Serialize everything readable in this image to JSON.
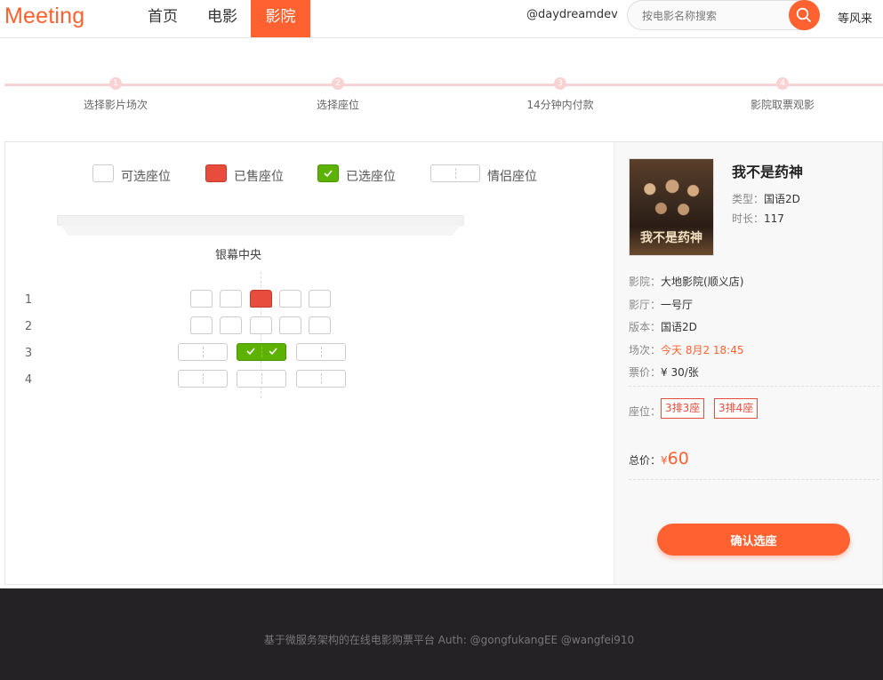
{
  "header": {
    "logo": "Meeting",
    "nav": [
      "首页",
      "电影",
      "影院"
    ],
    "user": "@daydreamdev",
    "search_placeholder": "按电影名称搜索",
    "right_user": "等风来"
  },
  "steps": [
    "选择影片场次",
    "选择座位",
    "14分钟内付款",
    "影院取票观影"
  ],
  "legend": {
    "available": "可选座位",
    "sold": "已售座位",
    "selected": "已选座位",
    "couple": "情侣座位"
  },
  "screen_label": "银幕中央",
  "rows": [
    "1",
    "2",
    "3",
    "4"
  ],
  "movie": {
    "title": "我不是药神",
    "type_label": "类型：",
    "type": "国语2D",
    "duration_label": "时长：",
    "duration": "117"
  },
  "order": {
    "cinema_label": "影院：",
    "cinema": "大地影院(顺义店)",
    "hall_label": "影厅：",
    "hall": "一号厅",
    "version_label": "版本：",
    "version": "国语2D",
    "session_label": "场次：",
    "session": "今天 8月2 18:45",
    "ticket_label": "票价：",
    "ticket": "¥ 30/张",
    "seats_label": "座位：",
    "seats": [
      "3排3座",
      "3排4座"
    ],
    "total_label": "总价：",
    "total_currency": "¥",
    "total": "60",
    "confirm": "确认选座"
  },
  "footer": "基于微服务架构的在线电影购票平台 Auth: @gongfukangEE @wangfei910"
}
